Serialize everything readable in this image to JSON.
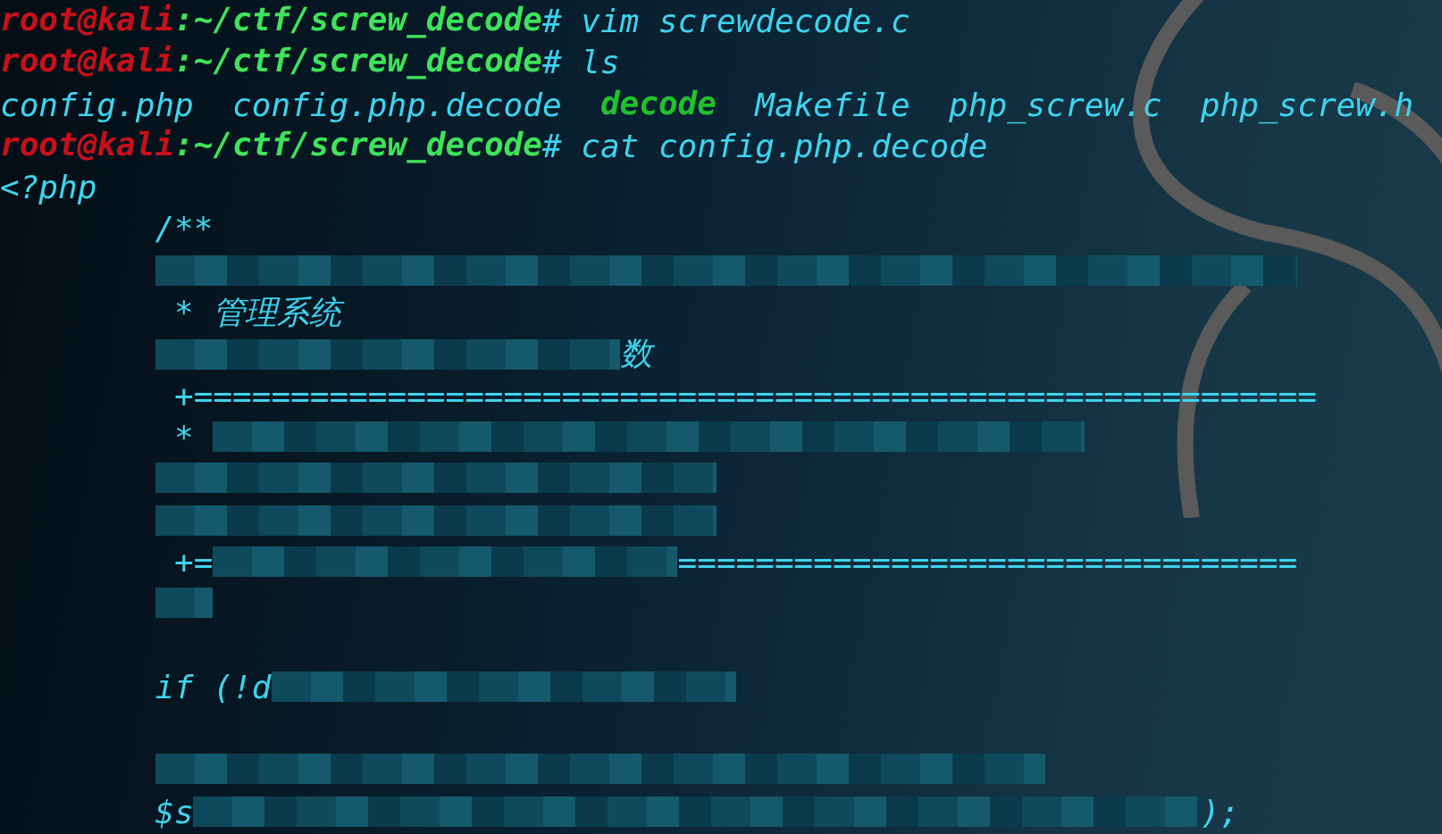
{
  "terminal": {
    "lines": [
      {
        "kind": "prompt",
        "user": "root@kali",
        "path": ":~/ctf/screw_decode",
        "command": "# vim screwdecode.c"
      },
      {
        "kind": "prompt",
        "user": "root@kali",
        "path": ":~/ctf/screw_decode",
        "command": "# ls"
      },
      {
        "kind": "listing",
        "items": [
          {
            "kind": "file",
            "name": "config.php"
          },
          {
            "kind": "file",
            "name": "config.php.decode"
          },
          {
            "kind": "executable",
            "name": "decode"
          },
          {
            "kind": "file",
            "name": "Makefile"
          },
          {
            "kind": "file",
            "name": "php_screw.c"
          },
          {
            "kind": "file",
            "name": "php_screw.h"
          }
        ]
      },
      {
        "kind": "prompt",
        "user": "root@kali",
        "path": ":~/ctf/screw_decode",
        "command": "# cat config.php.decode"
      },
      {
        "kind": "output",
        "segments": [
          {
            "kind": "text",
            "text": "<?php"
          }
        ]
      },
      {
        "kind": "code",
        "segments": [
          {
            "kind": "text",
            "text": "/**"
          }
        ]
      },
      {
        "kind": "code",
        "segments": [
          {
            "kind": "redacted"
          }
        ]
      },
      {
        "kind": "code",
        "segments": [
          {
            "kind": "text",
            "text": " * 管理系统"
          }
        ]
      },
      {
        "kind": "code",
        "segments": [
          {
            "kind": "redacted"
          },
          {
            "kind": "text",
            "text": "数"
          }
        ]
      },
      {
        "kind": "code",
        "segments": [
          {
            "kind": "text",
            "text": " +=========================================================="
          }
        ]
      },
      {
        "kind": "code",
        "segments": [
          {
            "kind": "text",
            "text": " * "
          },
          {
            "kind": "redacted"
          }
        ]
      },
      {
        "kind": "code",
        "segments": [
          {
            "kind": "redacted"
          }
        ]
      },
      {
        "kind": "code",
        "segments": [
          {
            "kind": "redacted"
          }
        ]
      },
      {
        "kind": "code",
        "segments": [
          {
            "kind": "text",
            "text": " +="
          },
          {
            "kind": "redacted"
          },
          {
            "kind": "text",
            "text": "================================"
          }
        ]
      },
      {
        "kind": "code",
        "segments": [
          {
            "kind": "redacted"
          }
        ]
      },
      {
        "kind": "blank"
      },
      {
        "kind": "code",
        "segments": [
          {
            "kind": "text",
            "text": "if (!d"
          },
          {
            "kind": "redacted"
          }
        ]
      },
      {
        "kind": "blank"
      },
      {
        "kind": "code",
        "segments": [
          {
            "kind": "redacted"
          }
        ]
      },
      {
        "kind": "code",
        "segments": [
          {
            "kind": "text",
            "text": "$s"
          },
          {
            "kind": "redacted"
          },
          {
            "kind": "text",
            "text": ");"
          }
        ]
      }
    ]
  }
}
